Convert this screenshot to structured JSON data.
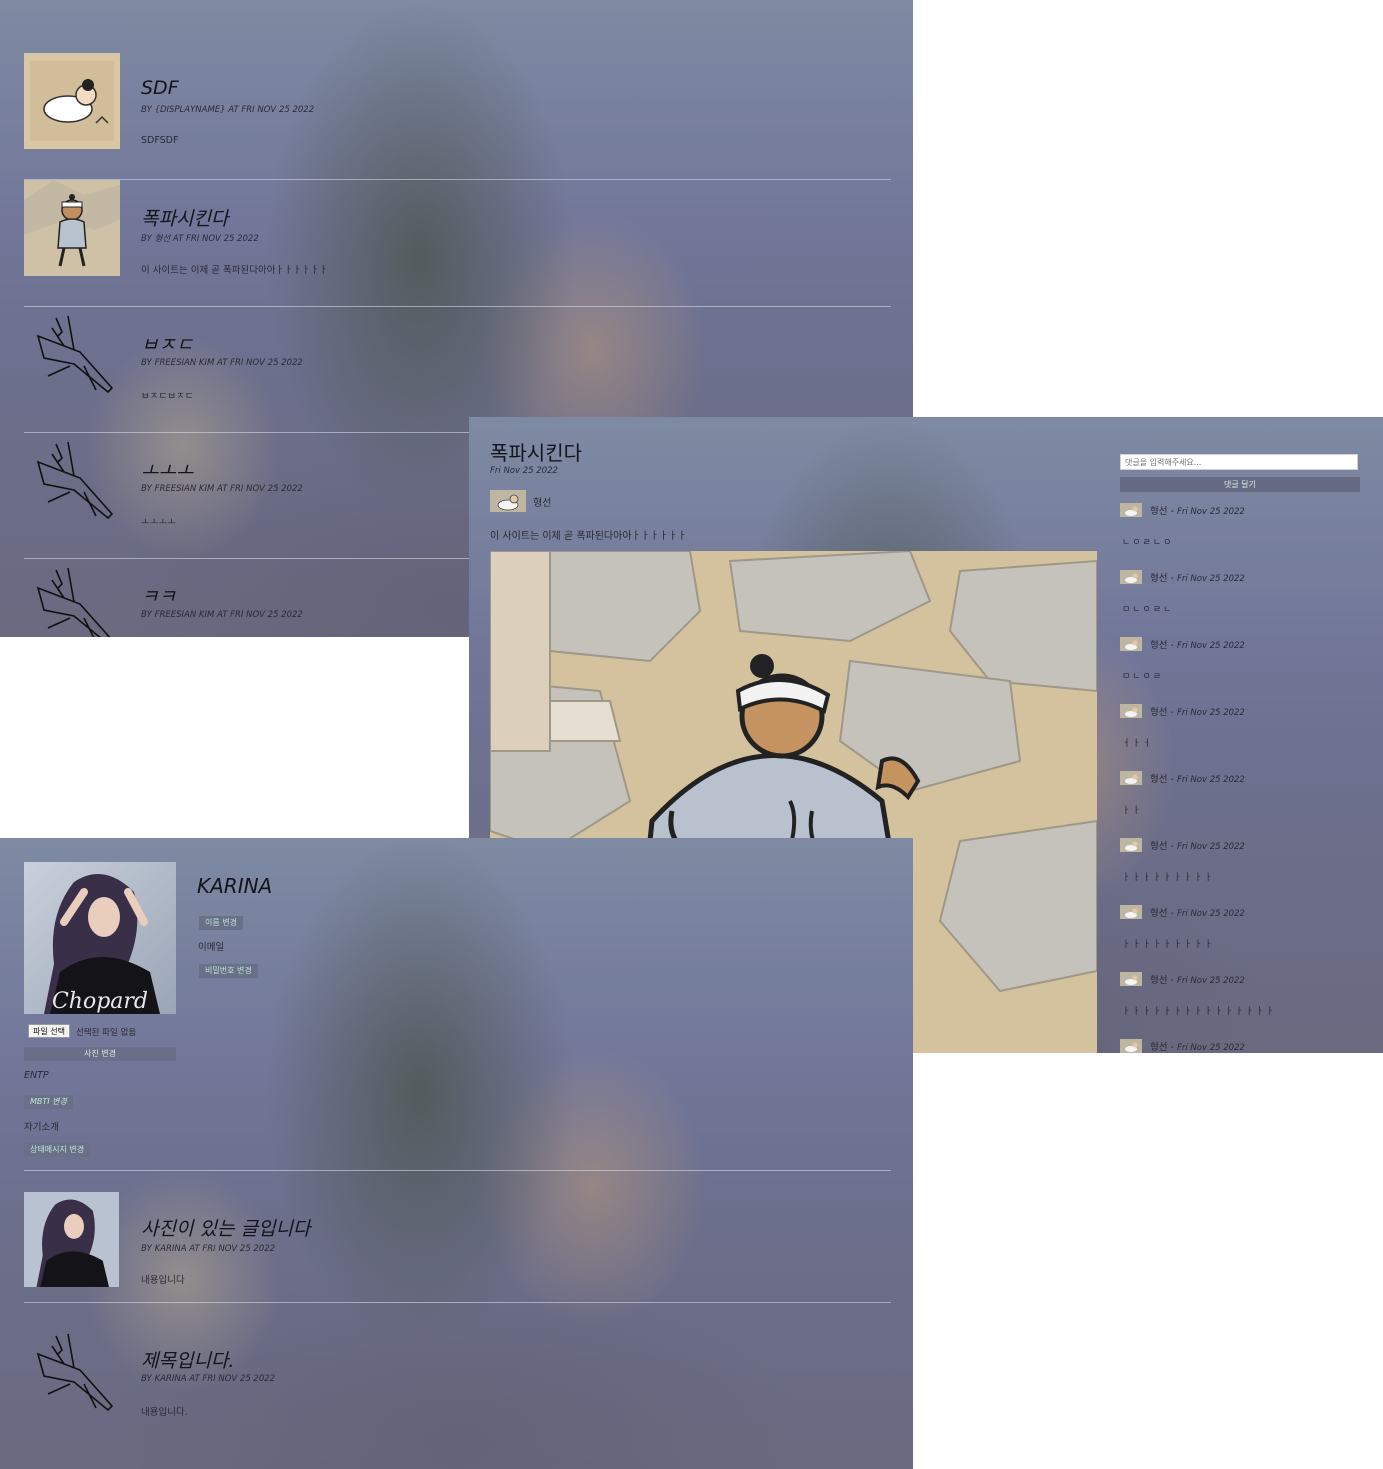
{
  "post_list": {
    "posts": [
      {
        "title": "SDF",
        "meta": "BY {DISPLAYNAME} AT FRI NOV 25 2022",
        "body": "SDFSDF",
        "thumb_icon": "baby-cartoon-icon"
      },
      {
        "title": "폭파시킨다",
        "meta": "BY 형선 AT FRI NOV 25 2022",
        "body": "이 사이트는 이제 곧 폭파된다아아ㅏㅏㅏㅏㅏㅏ",
        "thumb_icon": "dancing-man-cartoon-icon"
      },
      {
        "title": "ㅂㅈㄷ",
        "meta": "BY FREESIAN KIM AT FRI NOV 25 2022",
        "body": "ㅂㅈㄷㅂㅈㄷ",
        "thumb_icon": "fighter-jet-icon"
      },
      {
        "title": "ㅗㅗㅗ",
        "meta": "BY FREESIAN KIM AT FRI NOV 25 2022",
        "body": "ㅗㅗㅗㅗ",
        "thumb_icon": "fighter-jet-icon"
      },
      {
        "title": "ㅋㅋ",
        "meta": "BY FREESIAN KIM AT FRI NOV 25 2022",
        "body": "",
        "thumb_icon": "fighter-jet-icon"
      }
    ]
  },
  "post_detail": {
    "title": "폭파시킨다",
    "date": "Fri Nov 25 2022",
    "author": "형선",
    "body": "이 사이트는 이제 곧 폭파된다아아ㅏㅏㅏㅏㅏㅏ",
    "comment_placeholder": "댓글을 입력해주세요...",
    "comment_button": "댓글 달기",
    "comments": [
      {
        "author": "형선",
        "date": "Fri Nov 25 2022",
        "text": "ㄴㅇㄹㄴㅇ"
      },
      {
        "author": "형선",
        "date": "Fri Nov 25 2022",
        "text": "ㅁㄴㅇㄹㄴ"
      },
      {
        "author": "형선",
        "date": "Fri Nov 25 2022",
        "text": "ㅁㄴㅇㄹ"
      },
      {
        "author": "형선",
        "date": "Fri Nov 25 2022",
        "text": "ㅓㅏㅓ"
      },
      {
        "author": "형선",
        "date": "Fri Nov 25 2022",
        "text": "ㅏㅏ"
      },
      {
        "author": "형선",
        "date": "Fri Nov 25 2022",
        "text": "ㅏㅏㅏㅏㅏㅏㅏㅏㅏ"
      },
      {
        "author": "형선",
        "date": "Fri Nov 25 2022",
        "text": "ㅏㅏㅏㅏㅏㅏㅏㅏㅏ"
      },
      {
        "author": "형선",
        "date": "Fri Nov 25 2022",
        "text": "ㅏㅏㅏㅏㅏㅏㅏㅏㅏㅏㅏㅏㅏㅏㅏ"
      },
      {
        "author": "형선",
        "date": "Fri Nov 25 2022",
        "text": ""
      }
    ]
  },
  "profile": {
    "name": "KARINA",
    "change_name_btn": "이름 변경",
    "email_label": "이메일",
    "change_password_btn": "비밀번호 변경",
    "file_button": "파일 선택",
    "file_status": "선택된 파일 없음",
    "change_photo_btn": "사진 변경",
    "mbti": "ENTP",
    "change_mbti_btn": "MBTI 변경",
    "bio_label": "자기소개",
    "change_status_btn": "상태메시지 변경",
    "photo_logo_text": "Chopard",
    "posts": [
      {
        "title": "사진이 있는 글입니다",
        "meta": "BY KARINA AT FRI NOV 25 2022",
        "body": "내용입니다"
      },
      {
        "title": "제목입니다.",
        "meta": "BY KARINA AT FRI NOV 25 2022",
        "body": "내용입니다."
      }
    ]
  }
}
